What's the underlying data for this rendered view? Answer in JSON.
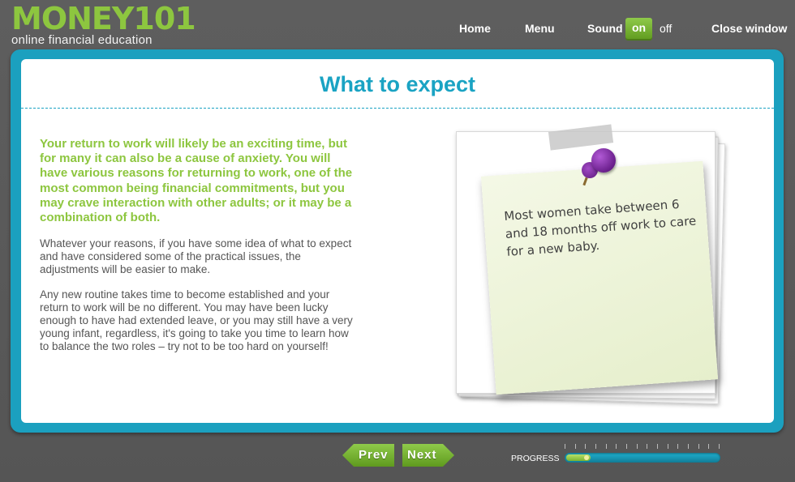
{
  "brand": {
    "logo": "MONEY101",
    "tagline": "online financial education"
  },
  "nav": {
    "home": "Home",
    "menu": "Menu",
    "sound_label": "Sound",
    "sound_on": "on",
    "sound_off": "off",
    "close": "Close window"
  },
  "main": {
    "title": "What to expect",
    "lead": "Your return to work will likely be an exciting time, but for many it can also be a cause of anxiety. You will have various reasons for returning to work, one of the most common being financial commitments, but you may crave interaction with other adults; or it may be a combination of both.",
    "paragraphs": [
      "Whatever your reasons, if you have some idea of what to expect and have considered some of the practical issues, the adjustments will be easier to make.",
      "Any new routine takes time to become established and your return to work will be no different. You may have been lucky enough to have had extended leave, or you may still have a very young infant, regardless, it's going to take you time to learn how to balance the two roles – try not to be too hard on yourself!"
    ],
    "note": "Most women take between 6 and 18 months off work to care for a new baby."
  },
  "footer": {
    "prev": "Prev",
    "next": "Next",
    "progress_label": "PROGRESS",
    "progress_fraction": 0.16
  },
  "colors": {
    "brand_green": "#8dc63f",
    "accent_teal": "#1ba0bf",
    "text_gray": "#555555"
  }
}
